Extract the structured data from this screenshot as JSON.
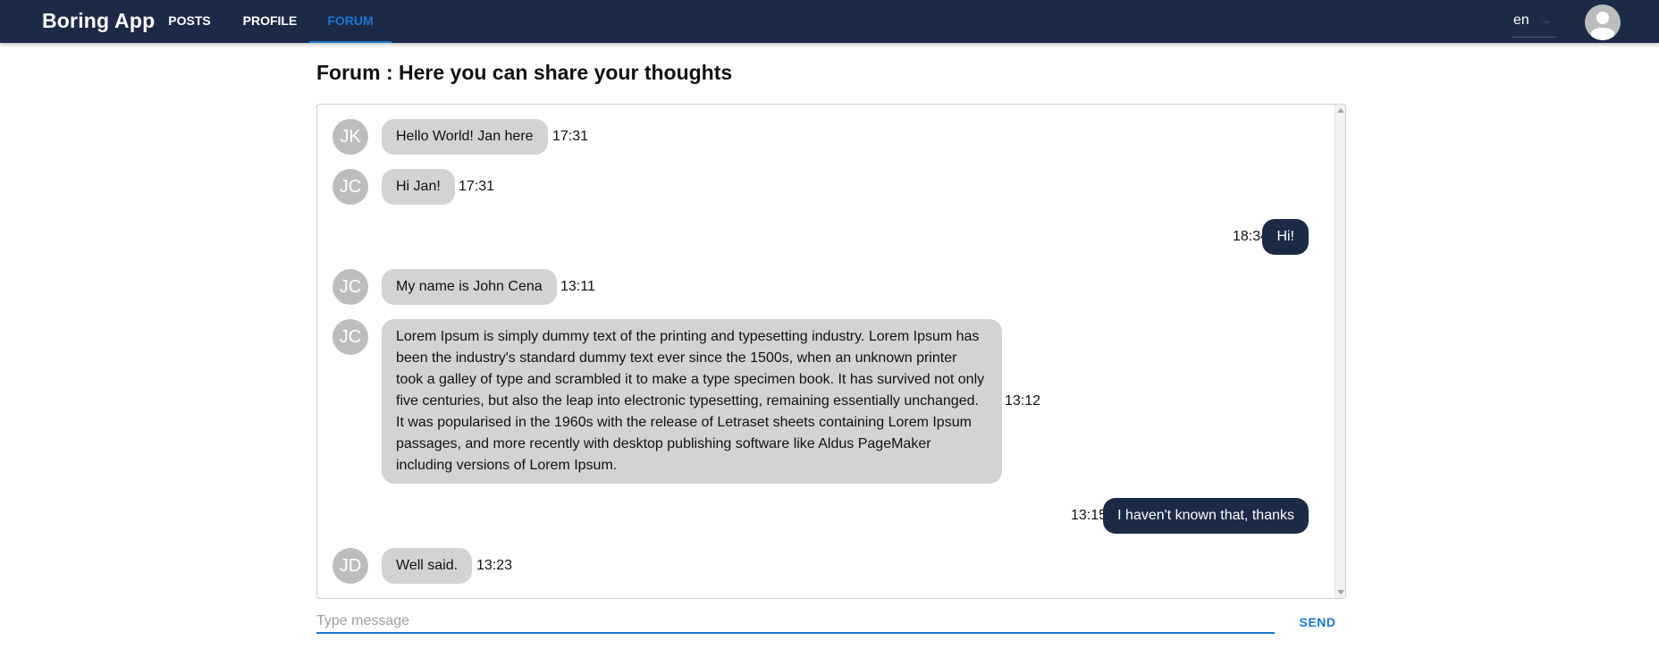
{
  "app": {
    "title": "Boring App"
  },
  "nav": {
    "tabs": [
      {
        "label": "POSTS",
        "active": false
      },
      {
        "label": "PROFILE",
        "active": false
      },
      {
        "label": "FORUM",
        "active": true
      }
    ]
  },
  "language": {
    "value": "en"
  },
  "page": {
    "title": "Forum : Here you can share your thoughts"
  },
  "messages": [
    {
      "initials": "JK",
      "text": "Hello World! Jan here",
      "time": "17:31",
      "direction": "incoming"
    },
    {
      "initials": "JC",
      "text": "Hi Jan!",
      "time": "17:31",
      "direction": "incoming"
    },
    {
      "initials": "",
      "text": "Hi!",
      "time": "18:34",
      "direction": "outgoing"
    },
    {
      "initials": "JC",
      "text": "My name is John Cena",
      "time": "13:11",
      "direction": "incoming"
    },
    {
      "initials": "JC",
      "text": "Lorem Ipsum is simply dummy text of the printing and typesetting industry. Lorem Ipsum has been the industry's standard dummy text ever since the 1500s, when an unknown printer took a galley of type and scrambled it to make a type specimen book. It has survived not only five centuries, but also the leap into electronic typesetting, remaining essentially unchanged. It was popularised in the 1960s with the release of Letraset sheets containing Lorem Ipsum passages, and more recently with desktop publishing software like Aldus PageMaker including versions of Lorem Ipsum.",
      "time": "13:12",
      "direction": "incoming"
    },
    {
      "initials": "",
      "text": "I haven't known that, thanks",
      "time": "13:15",
      "direction": "outgoing"
    },
    {
      "initials": "JD",
      "text": "Well said.",
      "time": "13:23",
      "direction": "incoming"
    }
  ],
  "composer": {
    "placeholder": "Type message",
    "value": "",
    "send_label": "SEND"
  },
  "colors": {
    "appbar": "#1c2a47",
    "accent": "#1976d2",
    "incoming_bubble": "#d3d3d3",
    "outgoing_bubble": "#1c2a47",
    "avatar": "#bdbdbd"
  },
  "icons": {
    "account": "account-circle-icon",
    "language_caret": "arrow-drop-down-icon"
  }
}
